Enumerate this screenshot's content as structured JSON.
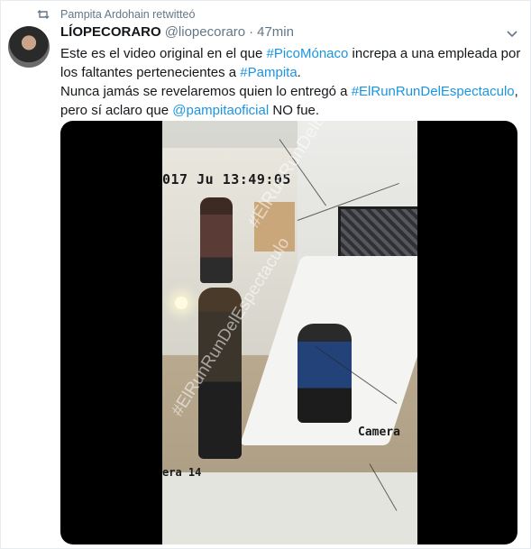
{
  "retweet": {
    "text": "Pampita Ardohain retwitteó",
    "icon": "retweet-icon"
  },
  "tweet": {
    "author_name": "LÍOPECORARO",
    "author_handle": "@liopecoraro",
    "separator": "·",
    "time": "47min",
    "lines": [
      {
        "parts": [
          {
            "t": "Este es el video original en el que ",
            "link": false
          },
          {
            "t": "#PicoMónaco",
            "link": true
          },
          {
            "t": " increpa a una empleada por",
            "link": false
          }
        ]
      },
      {
        "parts": [
          {
            "t": "los faltantes pertenecientes a ",
            "link": false
          },
          {
            "t": "#Pampita",
            "link": true
          },
          {
            "t": ".",
            "link": false
          }
        ]
      },
      {
        "parts": [
          {
            "t": "Nunca jamás se revelaremos quien lo entregó a ",
            "link": false
          },
          {
            "t": "#ElRunRunDelEspectaculo",
            "link": true
          },
          {
            "t": ",",
            "link": false
          }
        ]
      },
      {
        "parts": [
          {
            "t": "pero sí aclaro que ",
            "link": false
          },
          {
            "t": "@pampitaoficial",
            "link": true
          },
          {
            "t": " NO fue.",
            "link": false
          }
        ]
      }
    ]
  },
  "video": {
    "timestamp": "017 Ju 13:49:05",
    "camera_label": "Camera",
    "camera_bottom": "era 14",
    "watermark": "#ElRunRunDelEspectaculo"
  },
  "colors": {
    "link": "#1b95e0",
    "muted": "#657786",
    "text": "#14171a"
  }
}
